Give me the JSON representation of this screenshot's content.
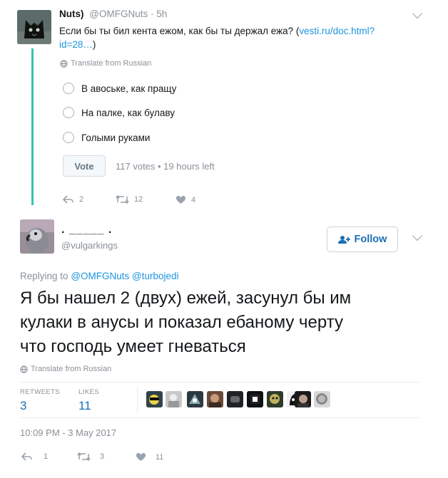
{
  "quoted_tweet": {
    "name": "Nuts)",
    "handle": "@OMFGNuts",
    "separator": "·",
    "time": "5h",
    "text": "Если бы ты бил кента ежом, как бы ты держал ежа?",
    "link_line1": "vesti.ru/doc.html?",
    "link_line2": "id=28…",
    "close_paren": ")",
    "translate": "Translate from Russian",
    "poll": {
      "options": [
        "В авоське, как пращу",
        "На палке, как булаву",
        "Голыми руками"
      ],
      "vote_label": "Vote",
      "meta": "117 votes • 19 hours left"
    },
    "actions": {
      "replies": "2",
      "retweets": "12",
      "likes": "4"
    }
  },
  "main_tweet": {
    "name": ". _____ .",
    "handle": "@vulgarkings",
    "follow_label": "Follow",
    "replying_prefix": "Replying to",
    "replying_to": [
      "@OMFGNuts",
      "@turbojedi"
    ],
    "text_lines": [
      "Я бы нашел 2 (двух) ежей, засунул бы им",
      "кулаки в анусы и показал ебаному черту",
      "что господь умеет гневаться"
    ],
    "translate": "Translate from Russian",
    "stats": {
      "retweets_label": "RETWEETS",
      "retweets": "3",
      "likes_label": "LIKES",
      "likes": "11"
    },
    "timestamp": "10:09 PM - 3 May 2017",
    "actions": {
      "replies": "1",
      "retweets": "3",
      "likes": "11"
    }
  },
  "colors": {
    "thread_line": "#36c2b0",
    "link": "#1b95e0",
    "like_heart": "#e0245e"
  },
  "icons": [
    "chevron-down-icon",
    "globe-icon",
    "reply-icon",
    "retweet-icon",
    "heart-icon",
    "follow-user-icon"
  ]
}
